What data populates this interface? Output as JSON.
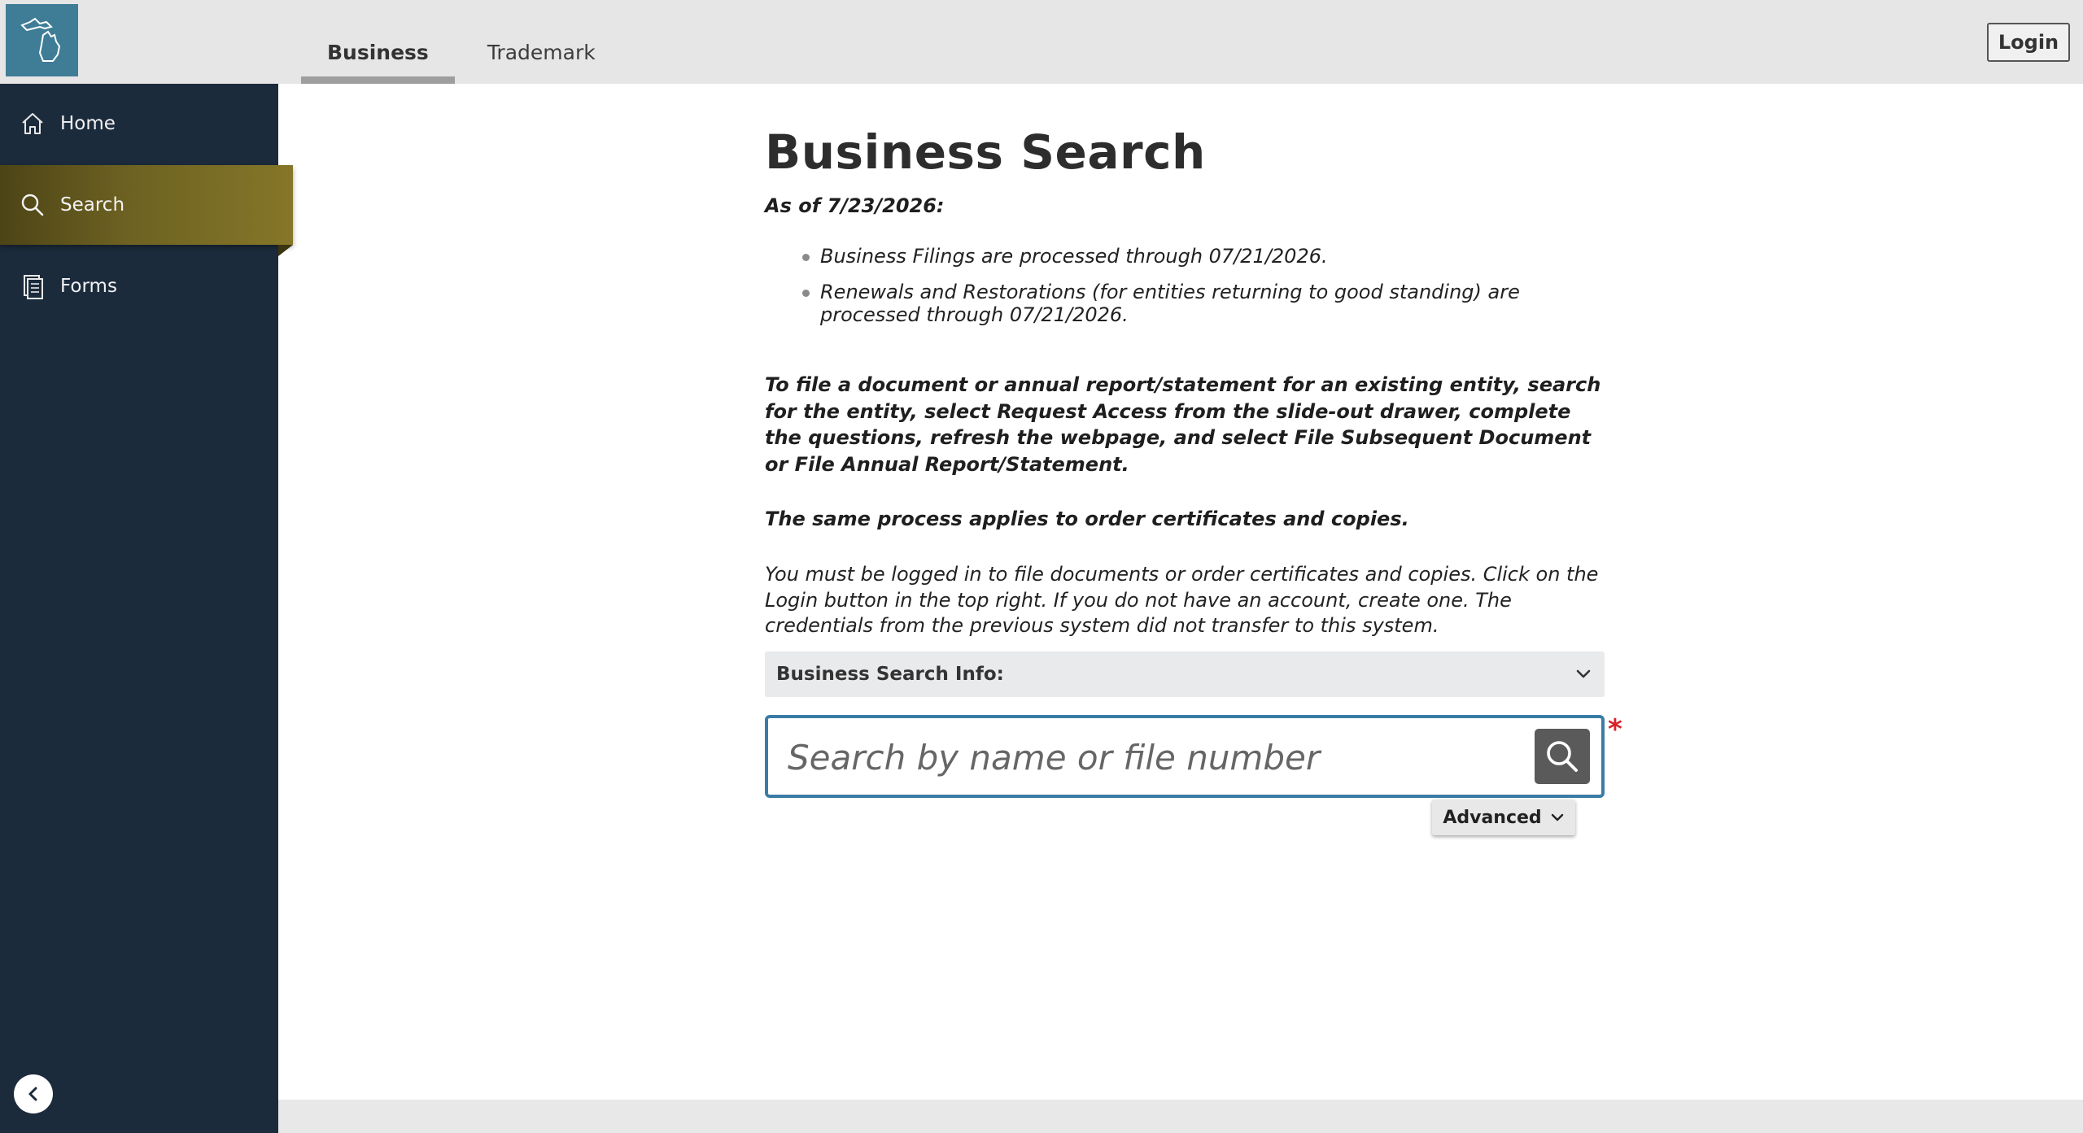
{
  "header": {
    "tabs": [
      {
        "label": "Business",
        "active": true
      },
      {
        "label": "Trademark",
        "active": false
      }
    ],
    "login_label": "Login"
  },
  "sidebar": {
    "items": [
      {
        "label": "Home",
        "icon": "home-icon"
      },
      {
        "label": "Search",
        "icon": "search-icon",
        "active": true
      },
      {
        "label": "Forms",
        "icon": "document-icon"
      }
    ]
  },
  "main": {
    "title": "Business Search",
    "as_of": "As of 7/23/2026:",
    "bullets": [
      "Business Filings are processed through 07/21/2026.",
      "Renewals and Restorations (for entities returning to good standing) are processed through 07/21/2026."
    ],
    "instructions": "To file a document or annual report/statement for an existing entity, search for the entity, select Request Access from the slide-out drawer, complete the questions, refresh the webpage, and select File Subsequent Document or File Annual Report/Statement.",
    "same_process": "The same process applies to order certificates and copies.",
    "login_note": "You must be logged in to file documents or order certificates and copies. Click on the Login button in the top right. If you do not have an account, create one. The credentials from the previous system did not transfer to this system.",
    "info_label": "Business Search Info:",
    "search_placeholder": "Search by name or file number",
    "search_value": "",
    "required_mark": "*",
    "advanced_label": "Advanced"
  },
  "colors": {
    "sidebar_bg": "#1c2b3c",
    "active_nav": "#857628",
    "logo_bg": "#3f7d97",
    "search_border": "#3a7ca5",
    "required": "#d8232a"
  }
}
